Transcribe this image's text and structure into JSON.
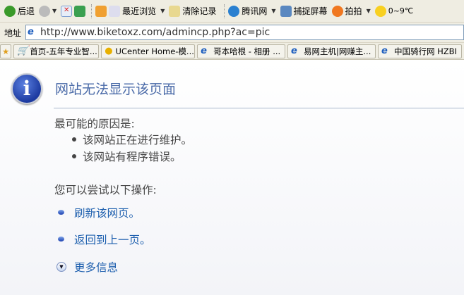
{
  "toolbar": {
    "back": "后退",
    "recent": "最近浏览",
    "clear": "清除记录",
    "qq": "腾讯网",
    "capture": "捕捉屏幕",
    "paipai": "拍拍",
    "weather": "0~9℃"
  },
  "address": {
    "label": "地址",
    "url": "http://www.biketoxz.com/admincp.php?ac=pic"
  },
  "favorites": [
    "首页-五年专业智...",
    "UCenter Home-模...",
    "哥本哈根 - 相册 ...",
    "易网主机|网赚主...",
    "中国骑行网 HZBI"
  ],
  "page": {
    "title": "网站无法显示该页面",
    "reasons_heading": "最可能的原因是:",
    "reasons": [
      "该网站正在进行维护。",
      "该网站有程序错误。"
    ],
    "actions_heading": "您可以尝试以下操作:",
    "actions": [
      "刷新该网页。",
      "返回到上一页。"
    ],
    "more": "更多信息"
  }
}
